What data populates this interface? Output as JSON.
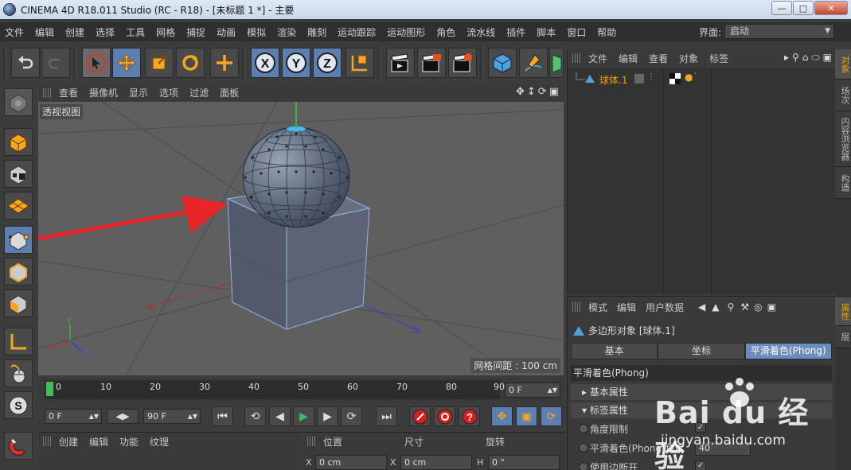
{
  "window": {
    "title": "CINEMA 4D R18.011 Studio (RC - R18) - [未标题 1 *] - 主要"
  },
  "menubar": {
    "items": [
      "文件",
      "编辑",
      "创建",
      "选择",
      "工具",
      "网格",
      "捕捉",
      "动画",
      "模拟",
      "渲染",
      "雕刻",
      "运动跟踪",
      "运动图形",
      "角色",
      "流水线",
      "插件",
      "脚本",
      "窗口",
      "帮助"
    ],
    "layout_label": "界面:",
    "layout_value": "启动"
  },
  "viewport": {
    "menu": [
      "查看",
      "摄像机",
      "显示",
      "选项",
      "过滤",
      "面板"
    ],
    "view_label": "透视视图",
    "grid_distance": "网格间距 : 100 cm",
    "axis_labels": {
      "y": "Y",
      "x": "X",
      "z": "Z"
    }
  },
  "timeline": {
    "ticks": [
      "0",
      "10",
      "20",
      "30",
      "40",
      "50",
      "60",
      "70",
      "80",
      "90"
    ],
    "current_frame": "0 F"
  },
  "transport": {
    "start_frame": "0 F",
    "end_frame": "90 F"
  },
  "material_panel": {
    "menu": [
      "创建",
      "编辑",
      "功能",
      "纹理"
    ]
  },
  "coord_panel": {
    "headers": {
      "position": "位置",
      "size": "尺寸",
      "rotation": "旋转"
    },
    "x_pos": "0 cm",
    "x_size": "0 cm",
    "h_rot": "0 °",
    "axis_x": "X",
    "axis_x2": "X",
    "axis_h": "H"
  },
  "object_manager": {
    "menu": [
      "文件",
      "编辑",
      "查看",
      "对象",
      "标签"
    ],
    "objects": [
      {
        "name": "球体.1"
      }
    ]
  },
  "attribute_manager": {
    "menu": [
      "模式",
      "编辑",
      "用户数据"
    ],
    "object_title": "多边形对象 [球体.1]",
    "tabs": [
      "基本",
      "坐标",
      "平滑着色(Phong)"
    ],
    "section_title": "平滑着色(Phong)",
    "groups": [
      "基本属性",
      "标签属性"
    ],
    "props": [
      {
        "label": "角度限制",
        "value": "✓"
      },
      {
        "label": "平滑着色(Phong)角度",
        "value": "40"
      },
      {
        "label": "使用边断开",
        "value": "✓"
      }
    ]
  },
  "side_tabs": [
    "对象",
    "场次",
    "内容浏览器",
    "构造",
    "属性",
    "层"
  ],
  "watermark": {
    "brand": "Bai du 经验",
    "url": "jingyan.baidu.com"
  },
  "colors": {
    "accent_blue": "#5a7fb0",
    "object_orange": "#f0a000",
    "arrow_red": "#e8262a",
    "active_green": "#3fbf5a"
  }
}
